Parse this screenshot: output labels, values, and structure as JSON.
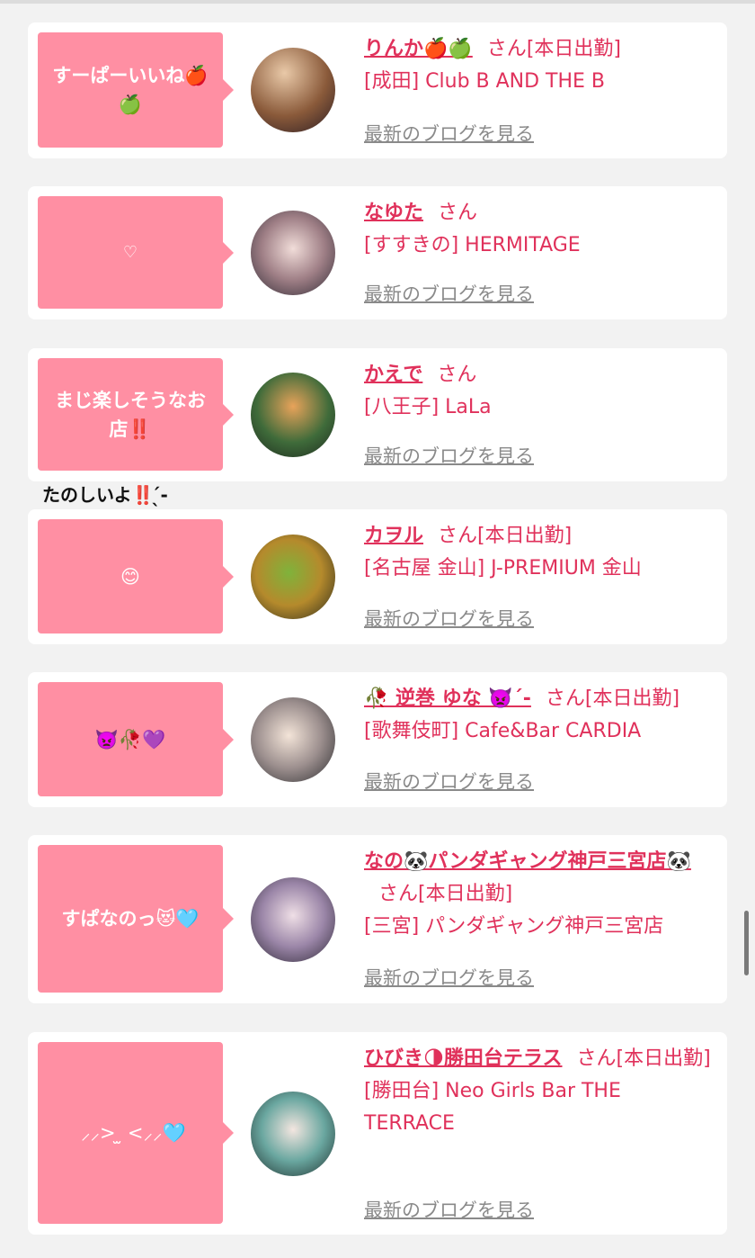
{
  "entries": [
    {
      "bubble": "すーぱーいいね🍎🍏",
      "name": "りんか🍎🍏",
      "san": "さん",
      "status": "[本日出勤]",
      "shop": "[成田] Club B AND THE B",
      "blog": "最新のブログを見る"
    },
    {
      "bubble": "♡",
      "name": "なゆた",
      "san": "さん",
      "status": "",
      "shop": "[すすきの] HERMITAGE",
      "blog": "最新のブログを見る"
    },
    {
      "bubble": "まじ楽しそうなお店‼️",
      "name": "かえで",
      "san": "さん",
      "status": "",
      "shop": "[八王子] LaLa",
      "blog": "最新のブログを見る"
    },
    {
      "bubble": "😊",
      "name": "カヲル",
      "san": "さん",
      "status": "[本日出勤]",
      "shop": "[名古屋 金山] J-PREMIUM 金山",
      "blog": "最新のブログを見る"
    },
    {
      "bubble": "👿🥀💜",
      "name": "🥀 逆巻 ゆな 👿´-",
      "san": "さん",
      "status": "[本日出勤]",
      "shop": "[歌舞伎町] Cafe&Bar CARDIA",
      "blog": "最新のブログを見る"
    },
    {
      "bubble": "すぱなのっ😻🩵",
      "name": "なの🐼パンダギャング神戸三宮店🐼",
      "san": "さん",
      "status": "[本日出勤]",
      "shop": "[三宮] パンダギャング神戸三宮店",
      "blog": "最新のブログを見る"
    },
    {
      "bubble": "‪‪ ⸝⸝> ̫ <⸝⸝🩵",
      "name": "ひびき🌗勝田台テラス",
      "san": "さん",
      "status": "[本日出勤]",
      "shop": "[勝田台] Neo Girls Bar THE TERRACE",
      "blog": "最新のブログを見る"
    }
  ],
  "comment": "たのしいよ‼️ ̖́-‬",
  "colors": {
    "accent": "#e0315b",
    "bubble": "#ff8fa3"
  }
}
